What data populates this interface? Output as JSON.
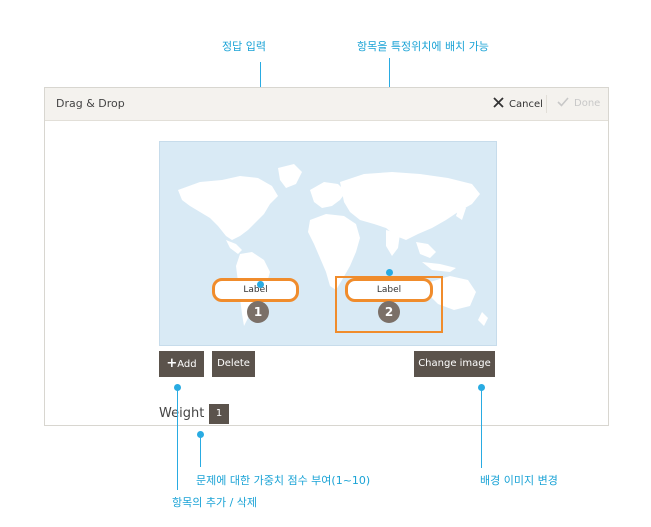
{
  "annotations": {
    "correct_input": "정답 입력",
    "place_item": "항목을 특정위치에 배치 가능",
    "weight_desc": "문제에 대한 가중치 점수 부여(1~10)",
    "add_delete": "항목의 추가 / 삭제",
    "change_bg": "배경 이미지 변경"
  },
  "dialog": {
    "title": "Drag & Drop",
    "cancel_label": "Cancel",
    "done_label": "Done"
  },
  "items": [
    {
      "label": "Label",
      "number": "1"
    },
    {
      "label": "Label",
      "number": "2"
    }
  ],
  "toolbar": {
    "add_label": "Add",
    "delete_label": "Delete",
    "change_image_label": "Change image"
  },
  "weight": {
    "label": "Weight :",
    "value": "1"
  },
  "colors": {
    "accent": "#f08c2c",
    "annotation": "#29abe2",
    "button": "#5b534c",
    "map_water": "#d9eaf5"
  }
}
